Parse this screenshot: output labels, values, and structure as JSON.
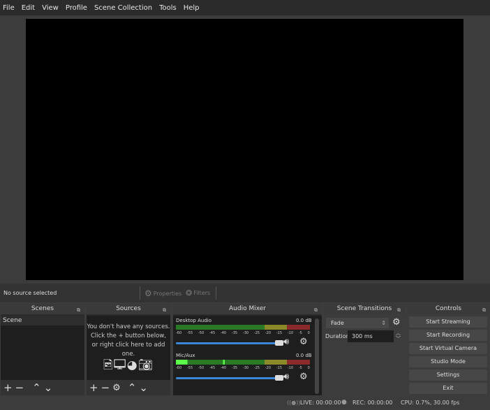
{
  "menu": [
    "File",
    "Edit",
    "View",
    "Profile",
    "Scene Collection",
    "Tools",
    "Help"
  ],
  "toolbar": {
    "status": "No source selected",
    "properties": "Properties",
    "filters": "Filters"
  },
  "scenes": {
    "title": "Scenes",
    "items": [
      "Scene"
    ]
  },
  "sources": {
    "title": "Sources",
    "empty_lines": [
      "You don't have any sources.",
      "Click the + button below,",
      "or right click here to add one."
    ]
  },
  "mixer": {
    "title": "Audio Mixer",
    "ticks": [
      "-60",
      "-55",
      "-50",
      "-45",
      "-40",
      "-35",
      "-30",
      "-25",
      "-20",
      "-15",
      "-10",
      "-5",
      "0"
    ],
    "channels": [
      {
        "name": "Desktop Audio",
        "level": "0.0 dB",
        "volume": 1.0
      },
      {
        "name": "Mic/Aux",
        "level": "0.0 dB",
        "volume": 1.0
      }
    ]
  },
  "transitions": {
    "title": "Scene Transitions",
    "selected": "Fade",
    "duration_label": "Duration",
    "duration": "300 ms"
  },
  "controls": {
    "title": "Controls",
    "buttons": [
      "Start Streaming",
      "Start Recording",
      "Start Virtual Camera",
      "Studio Mode",
      "Settings",
      "Exit"
    ]
  },
  "status": {
    "live": "LIVE: 00:00:00",
    "rec": "REC: 00:00:00",
    "cpu": "CPU: 0.7%, 30.00 fps"
  }
}
